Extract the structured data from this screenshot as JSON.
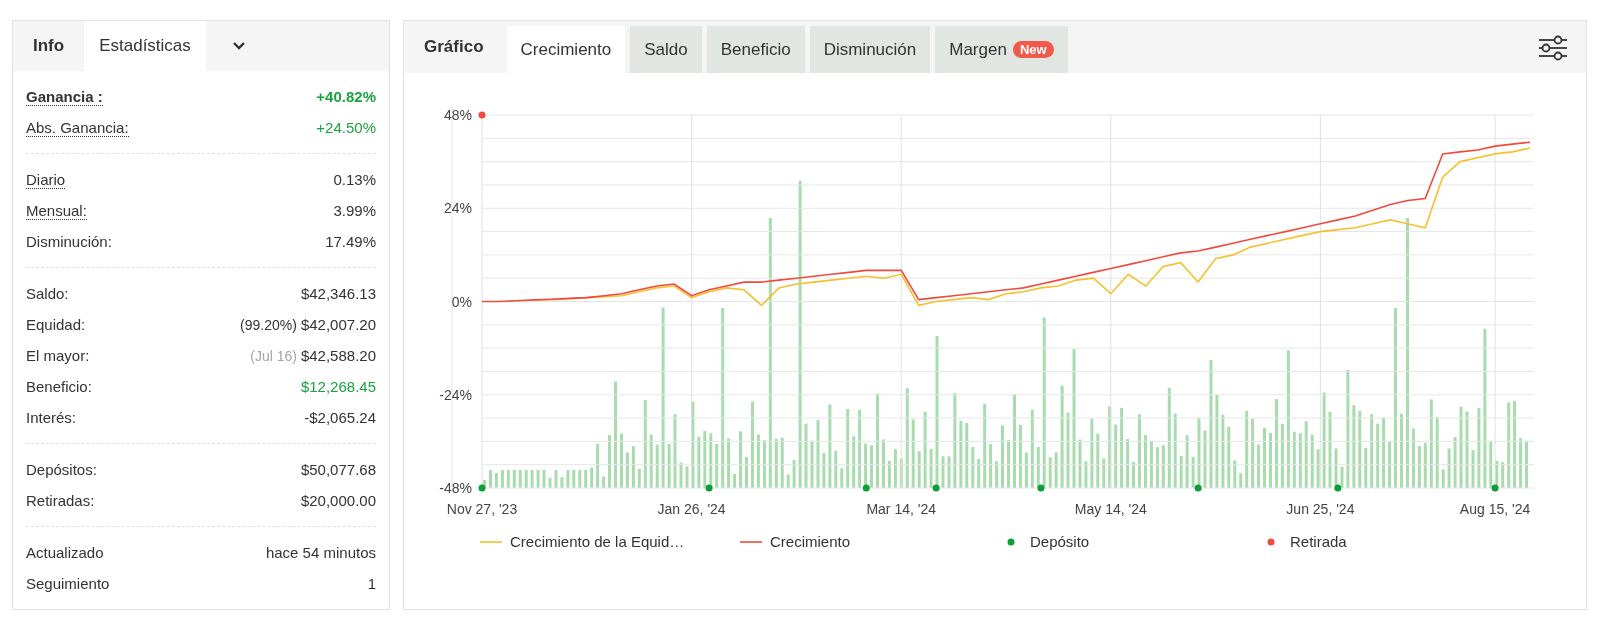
{
  "stats_panel": {
    "header": "Info",
    "tabs": [
      {
        "label": "Estadísticas",
        "selected": true
      }
    ],
    "sections": [
      {
        "rows": [
          {
            "label": "Ganancia :",
            "value": "+40.82%",
            "bold": true,
            "underlined": true,
            "color": "#1aa33f"
          },
          {
            "label": "Abs. Ganancia:",
            "value": "+24.50%",
            "bold": false,
            "underlined": true,
            "color": "#1aa33f"
          }
        ]
      },
      {
        "rows": [
          {
            "label": "Diario",
            "value": "0.13%",
            "bold": false,
            "underlined": true,
            "color": "#333333"
          },
          {
            "label": "Mensual:",
            "value": "3.99%",
            "bold": false,
            "underlined": true,
            "color": "#333333"
          },
          {
            "label": "Disminución:",
            "value": "17.49%",
            "bold": false,
            "underlined": false,
            "color": "#333333"
          }
        ]
      },
      {
        "rows": [
          {
            "label": "Saldo:",
            "value": "$42,346.13",
            "bold": false,
            "underlined": false,
            "color": "#333333"
          },
          {
            "label": "Equidad:",
            "note": "(99.20%)",
            "note_muted": false,
            "value": "$42,007.20",
            "bold": false,
            "underlined": false,
            "color": "#333333"
          },
          {
            "label": "El mayor:",
            "note": "(Jul 16)",
            "note_muted": true,
            "value": "$42,588.20",
            "bold": false,
            "underlined": false,
            "color": "#333333"
          },
          {
            "label": "Beneficio:",
            "value": "$12,268.45",
            "bold": false,
            "underlined": false,
            "color": "#1aa33f"
          },
          {
            "label": "Interés:",
            "value": "-$2,065.24",
            "bold": false,
            "underlined": false,
            "color": "#333333"
          }
        ]
      },
      {
        "rows": [
          {
            "label": "Depósitos:",
            "value": "$50,077.68",
            "bold": false,
            "underlined": false,
            "color": "#333333"
          },
          {
            "label": "Retiradas:",
            "value": "$20,000.00",
            "bold": false,
            "underlined": false,
            "color": "#333333"
          }
        ]
      },
      {
        "rows": [
          {
            "label": "Actualizado",
            "value": "hace 54 minutos",
            "bold": false,
            "underlined": false,
            "color": "#333333"
          },
          {
            "label": "Seguimiento",
            "value": "1",
            "bold": false,
            "underlined": false,
            "color": "#333333"
          }
        ]
      }
    ]
  },
  "chart_panel": {
    "header": "Gráfico",
    "tabs": [
      {
        "label": "Crecimiento",
        "selected": true
      },
      {
        "label": "Saldo",
        "selected": false
      },
      {
        "label": "Beneficio",
        "selected": false
      },
      {
        "label": "Disminución",
        "selected": false
      },
      {
        "label": "Margen",
        "selected": false,
        "badge": "New"
      }
    ],
    "chart_data": {
      "type": "line",
      "categories": [
        "Nov 27, '23",
        null,
        null,
        null,
        null,
        null,
        null,
        null,
        null,
        null,
        null,
        null,
        "Jan 26, '24",
        null,
        null,
        null,
        null,
        null,
        null,
        null,
        null,
        null,
        null,
        null,
        "Mar 14, '24",
        null,
        null,
        null,
        null,
        null,
        null,
        null,
        null,
        null,
        null,
        null,
        "May 14, '24",
        null,
        null,
        null,
        null,
        null,
        null,
        null,
        null,
        null,
        null,
        null,
        "Jun 25, '24",
        null,
        null,
        null,
        null,
        null,
        null,
        null,
        null,
        null,
        "Aug 15, '24",
        null,
        null
      ],
      "ylim": [
        -48,
        48
      ],
      "grid": true,
      "yticks": [
        {
          "value": 48,
          "label": "48%"
        },
        {
          "value": 24,
          "label": "24%"
        },
        {
          "value": 0,
          "label": "0%"
        },
        {
          "value": -24,
          "label": "-24%"
        },
        {
          "value": -48,
          "label": "-48%"
        }
      ],
      "series": [
        {
          "name": "Crecimiento de la Equid…",
          "type": "line",
          "color": "#f5c12e",
          "values": [
            null,
            null,
            null,
            0.4,
            0.5,
            0.7,
            1,
            1.2,
            1.5,
            2.5,
            3.5,
            4,
            1,
            2.5,
            3.5,
            3,
            -1,
            3.5,
            4.5,
            5,
            5.5,
            6,
            6.5,
            6,
            7,
            -1,
            0,
            0.5,
            1,
            0.5,
            2,
            2.5,
            3.5,
            4,
            5.5,
            6,
            2,
            7,
            4,
            9,
            10,
            5,
            11,
            12,
            14,
            15,
            16,
            17,
            18,
            18.5,
            19,
            20,
            21,
            20,
            19,
            32,
            36,
            37,
            38,
            38.5,
            39.5
          ]
        },
        {
          "name": "Crecimiento",
          "type": "line",
          "color": "#f04a3e",
          "values": [
            0,
            0,
            0.2,
            0.4,
            0.6,
            0.8,
            1,
            1.5,
            2,
            3,
            4,
            4.5,
            1.5,
            3,
            4,
            5,
            5,
            5.5,
            6,
            6.5,
            7,
            7.5,
            8,
            8,
            8,
            0.5,
            1,
            1.5,
            2,
            2.5,
            3,
            3.5,
            4.5,
            5.5,
            6.5,
            7.5,
            8.5,
            9.5,
            10.5,
            11.5,
            12.5,
            13,
            14,
            15,
            16,
            17,
            18,
            19,
            20,
            21,
            22,
            23.5,
            25,
            26,
            26.5,
            38,
            38.5,
            39,
            40,
            40.5,
            41
          ]
        },
        {
          "name": "Depósito",
          "type": "scatter",
          "color": "#0a9e3a",
          "values": [
            -48,
            null,
            null,
            null,
            null,
            null,
            null,
            null,
            null,
            null,
            null,
            null,
            null,
            -48,
            null,
            null,
            null,
            null,
            null,
            null,
            null,
            null,
            -48,
            null,
            null,
            null,
            -48,
            null,
            null,
            null,
            null,
            null,
            -48,
            null,
            null,
            null,
            null,
            null,
            null,
            null,
            null,
            -48,
            null,
            null,
            null,
            null,
            null,
            null,
            null,
            -48,
            null,
            null,
            null,
            null,
            null,
            null,
            null,
            null,
            -48,
            null,
            null
          ]
        },
        {
          "name": "Retirada",
          "type": "scatter",
          "color": "#f04a3e",
          "values": [
            48,
            null,
            null,
            null,
            null,
            null,
            null,
            null,
            null,
            null,
            null,
            null,
            null,
            null,
            null,
            null,
            null,
            null,
            null,
            null,
            null,
            null,
            null,
            null,
            null,
            null,
            null,
            null,
            null,
            null,
            null,
            null,
            null,
            null,
            null,
            null,
            null,
            null,
            null,
            null,
            null,
            null,
            null,
            null,
            null,
            null,
            null,
            null,
            null,
            null,
            null,
            null,
            null,
            null,
            null,
            null,
            null,
            null,
            null,
            null,
            null
          ]
        }
      ]
    }
  }
}
